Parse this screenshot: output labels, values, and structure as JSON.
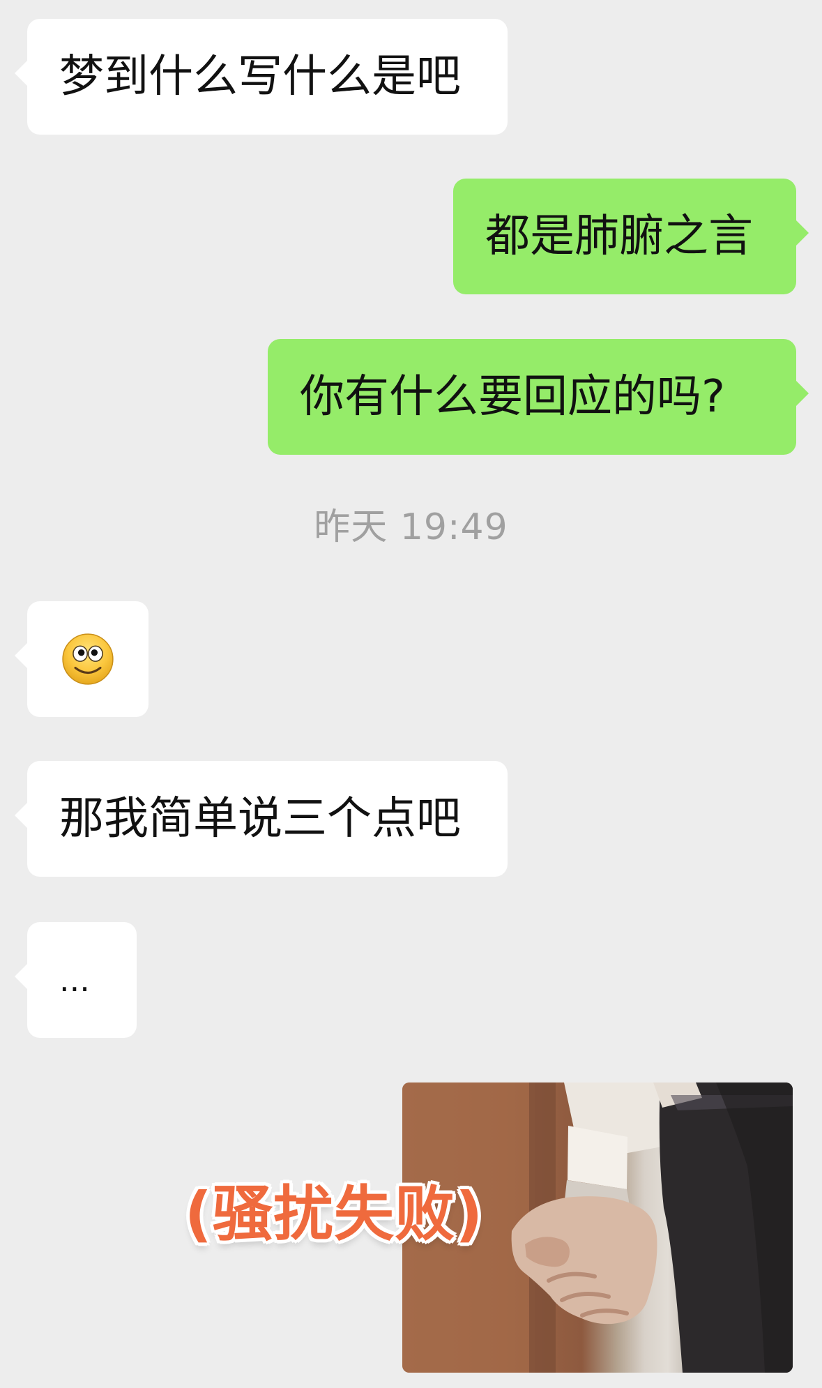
{
  "chat": {
    "messages": [
      {
        "id": "msg1",
        "side": "incoming",
        "text": "梦到什么写什么是吧"
      },
      {
        "id": "msg2",
        "side": "outgoing",
        "text": "都是肺腑之言"
      },
      {
        "id": "msg3",
        "side": "outgoing",
        "text": "你有什么要回应的吗?"
      },
      {
        "id": "msg5",
        "side": "incoming",
        "icon": "smiley-face-emoji"
      },
      {
        "id": "msg6",
        "side": "incoming",
        "text": "那我简单说三个点吧"
      },
      {
        "id": "msg7",
        "side": "incoming",
        "text": "..."
      }
    ],
    "timestamp": "昨天 19:49",
    "sticker": {
      "caption": "(骚扰失败)"
    }
  },
  "colors": {
    "background": "#ededed",
    "incoming_bubble": "#ffffff",
    "outgoing_bubble": "#95ec69",
    "timestamp_text": "#a0a0a0",
    "sticker_caption": "#ef6a3d"
  }
}
